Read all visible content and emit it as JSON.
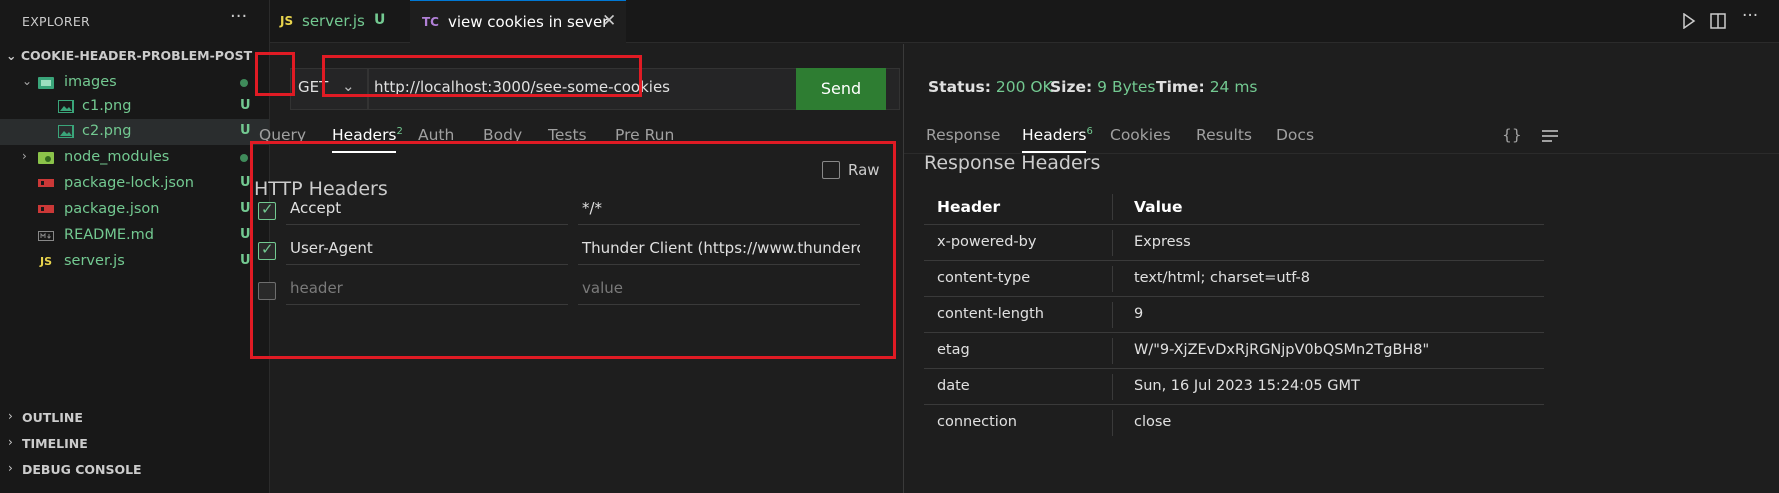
{
  "sidebar": {
    "title": "EXPLORER",
    "more": "···",
    "root": "COOKIE-HEADER-PROBLEM-POST",
    "tree": [
      {
        "label": "images",
        "badge": "",
        "dot": true,
        "chevron": "⌄"
      },
      {
        "label": "c1.png",
        "badge": "U"
      },
      {
        "label": "c2.png",
        "badge": "U"
      },
      {
        "label": "node_modules",
        "badge": "",
        "dot": true,
        "chevron": "›"
      },
      {
        "label": "package-lock.json",
        "badge": "U"
      },
      {
        "label": "package.json",
        "badge": "U"
      },
      {
        "label": "README.md",
        "badge": "U"
      },
      {
        "label": "server.js",
        "badge": "U",
        "icon_text": "JS"
      }
    ],
    "sections": [
      {
        "label": "OUTLINE"
      },
      {
        "label": "TIMELINE"
      },
      {
        "label": "DEBUG CONSOLE"
      }
    ]
  },
  "tabs": [
    {
      "icon": "JS",
      "label": "server.js",
      "badge": "U"
    },
    {
      "icon": "TC",
      "label": "view cookies in sever",
      "close": "✕"
    }
  ],
  "request": {
    "method": "GET",
    "url": "http://localhost:3000/see-some-cookies",
    "send_label": "Send",
    "tabs": [
      {
        "label": "Query"
      },
      {
        "label": "Headers",
        "count": "2"
      },
      {
        "label": "Auth"
      },
      {
        "label": "Body"
      },
      {
        "label": "Tests"
      },
      {
        "label": "Pre Run"
      }
    ],
    "headers_title": "HTTP Headers",
    "raw_label": "Raw",
    "headers": [
      {
        "name": "Accept",
        "value": "*/*",
        "checked": true
      },
      {
        "name": "User-Agent",
        "value": "Thunder Client (https://www.thunderclient.c",
        "checked": true
      }
    ],
    "placeholder_name": "header",
    "placeholder_value": "value"
  },
  "response": {
    "status_label": "Status:",
    "status_value": "200 OK",
    "size_label": "Size:",
    "size_value": "9 Bytes",
    "time_label": "Time:",
    "time_value": "24 ms",
    "tabs": [
      {
        "label": "Response"
      },
      {
        "label": "Headers",
        "count": "6"
      },
      {
        "label": "Cookies"
      },
      {
        "label": "Results"
      },
      {
        "label": "Docs"
      }
    ],
    "braces": "{}",
    "headers_title": "Response Headers",
    "col_header": "Header",
    "col_value": "Value",
    "rows": [
      {
        "name": "x-powered-by",
        "value": "Express"
      },
      {
        "name": "content-type",
        "value": "text/html; charset=utf-8"
      },
      {
        "name": "content-length",
        "value": "9"
      },
      {
        "name": "etag",
        "value": "W/\"9-XjZEvDxRjRGNjpV0bQSMn2TgBH8\""
      },
      {
        "name": "date",
        "value": "Sun, 16 Jul 2023 15:24:05 GMT"
      },
      {
        "name": "connection",
        "value": "close"
      }
    ]
  },
  "colors": {
    "accent_green": "#73c991",
    "send_button": "#2e7d32",
    "highlight_red": "#e01b24"
  }
}
